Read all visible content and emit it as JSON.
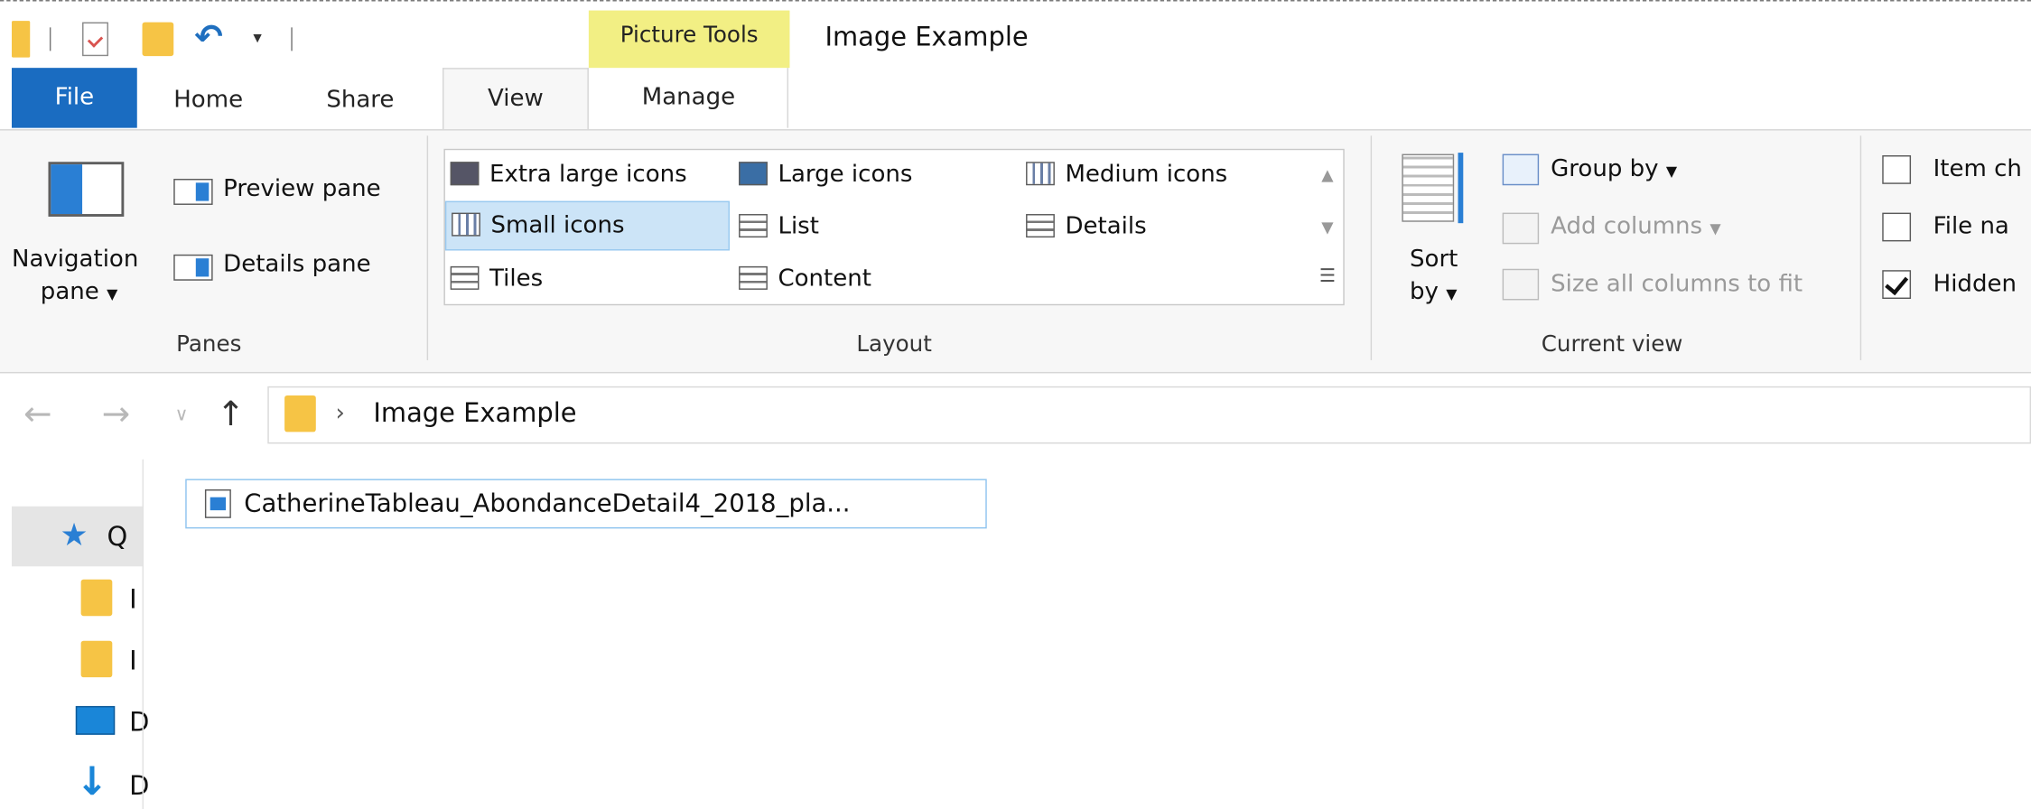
{
  "window": {
    "contextual_tab_group": "Picture Tools",
    "title": "Image Example"
  },
  "tabs": {
    "file": "File",
    "home": "Home",
    "share": "Share",
    "view": "View",
    "manage": "Manage"
  },
  "ribbon": {
    "panes": {
      "navigation_pane_line1": "Navigation",
      "navigation_pane_line2": "pane",
      "preview_pane": "Preview pane",
      "details_pane": "Details pane",
      "group_label": "Panes"
    },
    "layout": {
      "extra_large_icons": "Extra large icons",
      "large_icons": "Large icons",
      "medium_icons": "Medium icons",
      "small_icons": "Small icons",
      "list": "List",
      "details": "Details",
      "tiles": "Tiles",
      "content": "Content",
      "selected": "Small icons",
      "group_label": "Layout"
    },
    "current_view": {
      "sort_by_line1": "Sort",
      "sort_by_line2": "by",
      "group_by": "Group by",
      "add_columns": "Add columns",
      "size_all_columns": "Size all columns to fit",
      "group_label": "Current view"
    },
    "show_hide": {
      "item_check_boxes": "Item ch",
      "file_name_extensions": "File na",
      "hidden_items": "Hidden",
      "item_check_boxes_checked": false,
      "file_name_extensions_checked": false,
      "hidden_items_checked": true
    }
  },
  "address_bar": {
    "separator": "›",
    "current_folder": "Image Example"
  },
  "nav_pane": {
    "quick_access": "Q",
    "items": [
      "I",
      "I",
      "D",
      "D"
    ]
  },
  "files": [
    {
      "name": "CatherineTableau_AbondanceDetail4_2018_pla..."
    }
  ],
  "icons": {
    "back": "arrow-left-icon",
    "forward": "arrow-right-icon",
    "recent": "chevron-down-icon",
    "up": "arrow-up-icon"
  }
}
